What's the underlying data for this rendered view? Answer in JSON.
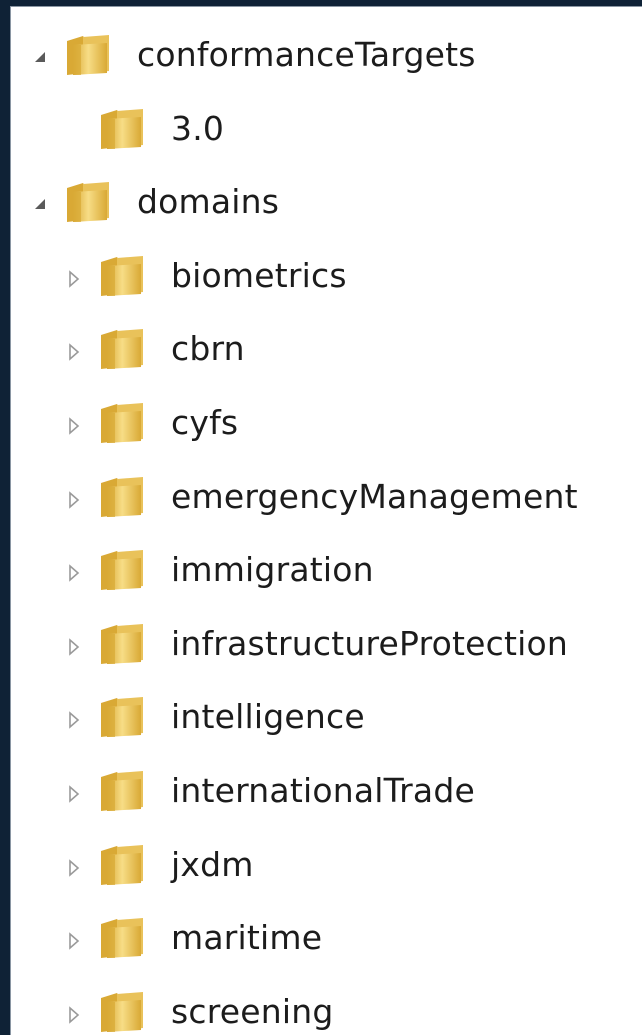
{
  "tree": {
    "items": [
      {
        "label": "conformanceTargets",
        "level": 0,
        "expander": "expanded"
      },
      {
        "label": "3.0",
        "level": 1,
        "expander": "none"
      },
      {
        "label": "domains",
        "level": 0,
        "expander": "expanded"
      },
      {
        "label": "biometrics",
        "level": 1,
        "expander": "collapsed"
      },
      {
        "label": "cbrn",
        "level": 1,
        "expander": "collapsed"
      },
      {
        "label": "cyfs",
        "level": 1,
        "expander": "collapsed"
      },
      {
        "label": "emergencyManagement",
        "level": 1,
        "expander": "collapsed"
      },
      {
        "label": "immigration",
        "level": 1,
        "expander": "collapsed"
      },
      {
        "label": "infrastructureProtection",
        "level": 1,
        "expander": "collapsed"
      },
      {
        "label": "intelligence",
        "level": 1,
        "expander": "collapsed"
      },
      {
        "label": "internationalTrade",
        "level": 1,
        "expander": "collapsed"
      },
      {
        "label": "jxdm",
        "level": 1,
        "expander": "collapsed"
      },
      {
        "label": "maritime",
        "level": 1,
        "expander": "collapsed"
      },
      {
        "label": "screening",
        "level": 1,
        "expander": "collapsed"
      }
    ]
  },
  "icons": {
    "folder": "folder-icon",
    "expanded": "expanded-arrow-icon",
    "collapsed": "collapsed-arrow-icon"
  },
  "colors": {
    "folder_light": "#f7dd86",
    "folder_dark": "#d9a935",
    "arrow_expanded": "#5a5a5a",
    "arrow_collapsed": "#9a9a9a",
    "text": "#1c1c1c"
  }
}
